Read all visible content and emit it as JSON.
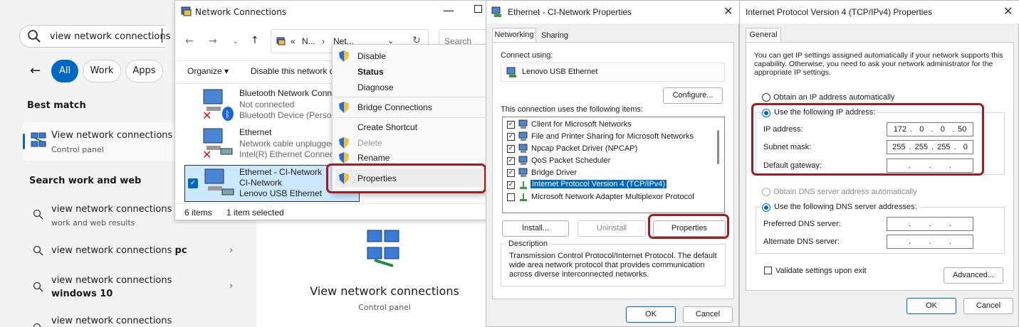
{
  "search_panel": {
    "query": "view network connections",
    "filters": [
      "All",
      "Work",
      "Apps"
    ],
    "best_match_heading": "Best match",
    "best_match_title": "View network connections",
    "best_match_sub": "Control panel",
    "search_work_web_heading": "Search work and web",
    "suggestions": [
      {
        "line1": "view network connections - S",
        "line2": "work and web results"
      },
      {
        "line1": "view network connections ",
        "bold": "pc"
      },
      {
        "line1": "view network connections",
        "bold": "windows 10"
      },
      {
        "line1": "view network connections"
      }
    ]
  },
  "preview": {
    "title": "View network connections",
    "subtitle": "Control panel"
  },
  "netwin": {
    "title": "Network Connections",
    "address_parts": [
      "«",
      "N...",
      "›",
      "Net..."
    ],
    "search_placeholder": "Search Net",
    "toolbar": [
      "Organize ▾",
      "Disable this network d"
    ],
    "items": [
      {
        "name": "Bluetooth Network Conn",
        "line2": "Not connected",
        "line3": "Bluetooth Device (Person"
      },
      {
        "name": "Ethernet",
        "line2": "Network cable unplugged",
        "line3": "Intel(R) Ethernet Connect"
      },
      {
        "name": "Ethernet - CI-Network",
        "line2": "CI-Network",
        "line3": "Lenovo USB Ethernet"
      }
    ],
    "status_count": "6 items",
    "status_selected": "1 item selected"
  },
  "context_menu": {
    "items": [
      "Disable",
      "Status",
      "Diagnose",
      "Bridge Connections",
      "Create Shortcut",
      "Delete",
      "Rename",
      "Properties"
    ]
  },
  "eth_dialog": {
    "title": "Ethernet - CI-Network Properties",
    "tabs": [
      "Networking",
      "Sharing"
    ],
    "connect_using_label": "Connect using:",
    "adapter": "Lenovo USB Ethernet",
    "configure": "Configure...",
    "items_label": "This connection uses the following items:",
    "items": [
      "Client for Microsoft Networks",
      "File and Printer Sharing for Microsoft Networks",
      "Npcap Packet Driver (NPCAP)",
      "QoS Packet Scheduler",
      "Bridge Driver",
      "Internet Protocol Version 4 (TCP/IPv4)",
      "Microsoft Network Adapter Multiplexor Protocol"
    ],
    "install": "Install...",
    "uninstall": "Uninstall",
    "properties": "Properties",
    "description_label": "Description",
    "description": "Transmission Control Protocol/Internet Protocol. The default wide area network protocol that provides communication across diverse interconnected networks.",
    "ok": "OK",
    "cancel": "Cancel"
  },
  "ip_dialog": {
    "title": "Internet Protocol Version 4 (TCP/IPv4) Properties",
    "tab": "General",
    "intro": "You can get IP settings assigned automatically if your network supports this capability. Otherwise, you need to ask your network administrator for the appropriate IP settings.",
    "auto_ip": "Obtain an IP address automatically",
    "use_ip": "Use the following IP address:",
    "ip_label": "IP address:",
    "ip_value": "172 .  0  .  0  . 50",
    "mask_label": "Subnet mask:",
    "mask_value": "255 . 255 . 255 .  0",
    "gateway_label": "Default gateway:",
    "gateway_value": ".     .     .",
    "auto_dns": "Obtain DNS server address automatically",
    "use_dns": "Use the following DNS server addresses:",
    "pref_dns_label": "Preferred DNS server:",
    "pref_dns_value": ".     .     .",
    "alt_dns_label": "Alternate DNS server:",
    "alt_dns_value": ".     .     .",
    "validate": "Validate settings upon exit",
    "advanced": "Advanced...",
    "ok": "OK",
    "cancel": "Cancel"
  },
  "colors": {
    "accent": "#0067c0",
    "highlight": "#9e1c23",
    "selection": "#cce8ff"
  }
}
